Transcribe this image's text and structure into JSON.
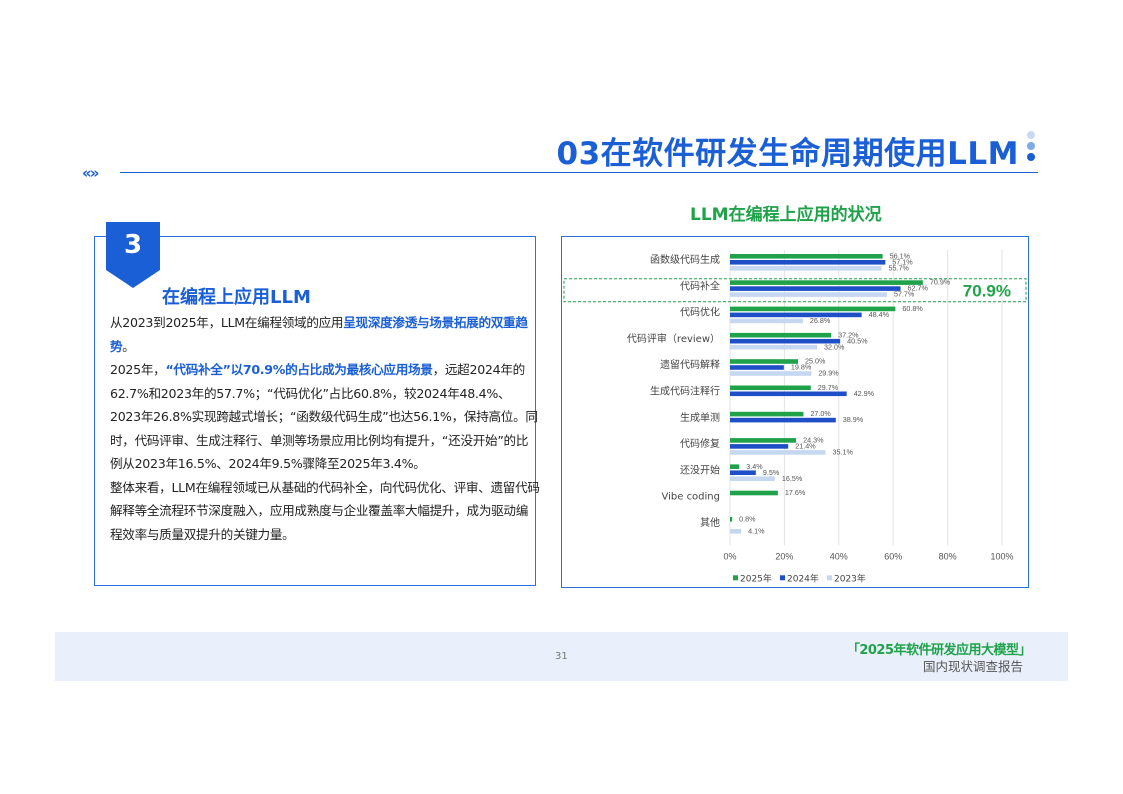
{
  "header": {
    "title": "03在软件研发生命周期使用LLM",
    "nav_icon": "double-chevron-icon",
    "accent_color": "#1a5fd6"
  },
  "chart_heading": "LLM在编程上应用的状况",
  "panel": {
    "badge_number": "3",
    "heading": "在编程上应用LLM",
    "paragraphs": [
      [
        {
          "text": "从2023到2025年，LLM在编程领域的应用",
          "hl": false
        },
        {
          "text": "呈现深度渗透与场景拓展的双重趋势",
          "hl": true
        },
        {
          "text": "。",
          "hl": false
        }
      ],
      [
        {
          "text": "2025年，",
          "hl": false
        },
        {
          "text": "“代码补全”以70.9%的占比成为最核心应用场景",
          "hl": true
        },
        {
          "text": "，远超2024年的62.7%和2023年的57.7%；“代码优化”占比60.8%，较2024年48.4%、2023年26.8%实现跨越式增长；“函数级代码生成”也达56.1%，保持高位。同时，代码评审、生成注释行、单测等场景应用比例均有提升，“还没开始”的比例从2023年16.5%、2024年9.5%骤降至2025年3.4%。",
          "hl": false
        }
      ],
      [
        {
          "text": "整体来看，LLM在编程领域已从基础的代码补全，向代码优化、评审、遗留代码解释等全流程环节深度融入，应用成熟度与企业覆盖率大幅提升，成为驱动编程效率与质量双提升的关键力量。",
          "hl": false
        }
      ]
    ]
  },
  "chart_data": {
    "type": "bar",
    "orientation": "horizontal",
    "categories": [
      "函数级代码生成",
      "代码补全",
      "代码优化",
      "代码评审（review）",
      "遗留代码解释",
      "生成代码注释行",
      "生成单测",
      "代码修复",
      "还没开始",
      "Vibe coding",
      "其他"
    ],
    "series": [
      {
        "name": "2025年",
        "color": "#1fa24a",
        "values": [
          56.1,
          70.9,
          60.8,
          37.2,
          25.0,
          29.7,
          27.0,
          24.3,
          3.4,
          17.6,
          0.8
        ]
      },
      {
        "name": "2024年",
        "color": "#1f4fc7",
        "values": [
          57.1,
          62.7,
          48.4,
          40.5,
          19.8,
          42.9,
          38.9,
          21.4,
          9.5,
          null,
          0.0
        ]
      },
      {
        "name": "2023年",
        "color": "#c5d7f1",
        "values": [
          55.7,
          57.7,
          26.8,
          32.0,
          29.9,
          null,
          null,
          35.1,
          16.5,
          null,
          4.1
        ]
      }
    ],
    "value_labels": [
      [
        "56.1%",
        "57.1%",
        "55.7%"
      ],
      [
        "70.9%",
        "62.7%",
        "57.7%"
      ],
      [
        "60.8%",
        "48.4%",
        "26.8%"
      ],
      [
        "37.2%",
        "40.5%",
        "32.0%"
      ],
      [
        "25.0%",
        "19.8%",
        "29.9%"
      ],
      [
        "29.7%",
        "42.9%",
        null
      ],
      [
        "27.0%",
        "38.9%",
        null
      ],
      [
        "24.3%",
        "21.4%",
        "35.1%"
      ],
      [
        "3.4%",
        "9.5%",
        "16.5%"
      ],
      [
        "17.6%",
        null,
        null
      ],
      [
        "0.8%",
        null,
        "4.1%"
      ]
    ],
    "xlim": [
      0,
      100
    ],
    "x_ticks": [
      "0%",
      "20%",
      "40%",
      "60%",
      "80%",
      "100%"
    ],
    "grid": true,
    "legend_position": "bottom",
    "highlight": {
      "category_index": 1,
      "label": "70.9%",
      "color": "#1fa24a"
    }
  },
  "footer": {
    "page_number": "31",
    "report_title": "「2025年软件研发应用大模型」",
    "report_subtitle": "国内现状调查报告",
    "background": "#e9f0fb"
  }
}
